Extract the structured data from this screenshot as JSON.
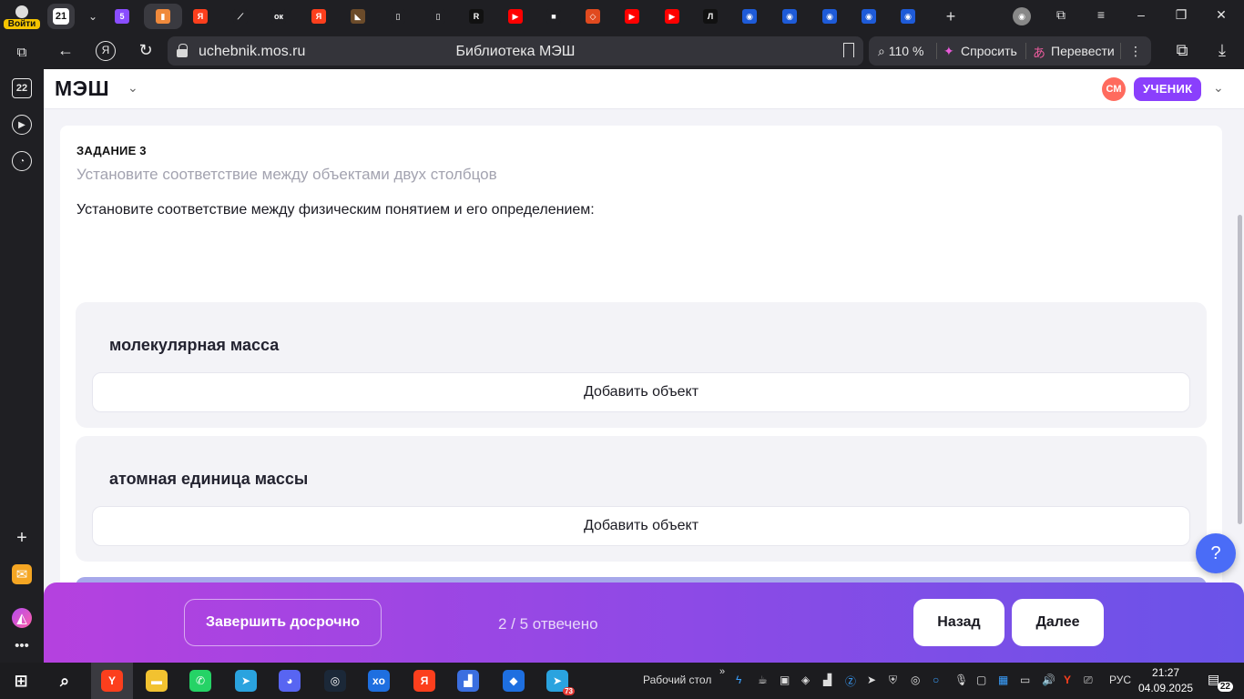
{
  "browser": {
    "login_label": "Войти",
    "tab_count": "21",
    "url": "uchebnik.mos.ru",
    "page_title": "Библиотека МЭШ",
    "zoom": "110 %",
    "ask_label": "Спросить",
    "translate_label": "Перевести",
    "rail_counter": "22",
    "tab_icons": [
      {
        "glyph": "5",
        "color": "#8a4dff"
      },
      {
        "glyph": "▮",
        "color": "#f08a3c"
      },
      {
        "glyph": "Я",
        "color": "#fc3f1d"
      },
      {
        "glyph": "⟋",
        "color": "#1f1f23"
      },
      {
        "glyph": "ок",
        "color": "#1f1f23"
      },
      {
        "glyph": "Я",
        "color": "#fc3f1d"
      },
      {
        "glyph": "◣",
        "color": "#6b4b2a"
      },
      {
        "glyph": "▯",
        "color": "#1f1f23"
      },
      {
        "glyph": "▯",
        "color": "#1f1f23"
      },
      {
        "glyph": "R",
        "color": "#111111"
      },
      {
        "glyph": "▶",
        "color": "#ff0000"
      },
      {
        "glyph": "■",
        "color": "#1f1f23"
      },
      {
        "glyph": "◇",
        "color": "#e04a1f"
      },
      {
        "glyph": "▶",
        "color": "#ff0000"
      },
      {
        "glyph": "▶",
        "color": "#ff0000"
      },
      {
        "glyph": "Л",
        "color": "#111111"
      },
      {
        "glyph": "◉",
        "color": "#1e5bd8"
      },
      {
        "glyph": "◉",
        "color": "#1e5bd8"
      },
      {
        "glyph": "◉",
        "color": "#1e5bd8"
      },
      {
        "glyph": "◉",
        "color": "#1e5bd8"
      },
      {
        "glyph": "◉",
        "color": "#1e5bd8"
      }
    ]
  },
  "header": {
    "logo": "МЭШ",
    "avatar_initials": "СМ",
    "role": "УЧЕНИК"
  },
  "task": {
    "label": "ЗАДАНИЕ 3",
    "instruction": "Установите соответствие между объектами двух столбцов",
    "question": "Установите соответствие между физическим понятием и его определением:",
    "groups": [
      {
        "title": "молекулярная масса",
        "add_label": "Добавить объект"
      },
      {
        "title": "атомная единица массы",
        "add_label": "Добавить объект"
      }
    ]
  },
  "footer": {
    "finish_label": "Завершить досрочно",
    "progress": "2 / 5 отвечено",
    "back_label": "Назад",
    "next_label": "Далее"
  },
  "help_glyph": "?",
  "taskbar": {
    "desktop_label": "Рабочий стол",
    "lang": "РУС",
    "time": "21:27",
    "date": "04.09.2025",
    "telegram_badge": "73",
    "notification_count": "22",
    "apps": [
      {
        "glyph": "Y",
        "color": "#fc3f1d"
      },
      {
        "glyph": "▬",
        "color": "#f2c230"
      },
      {
        "glyph": "✆",
        "color": "#25d366"
      },
      {
        "glyph": "➤",
        "color": "#2aa3df"
      },
      {
        "glyph": "◕",
        "color": "#5865f2"
      },
      {
        "glyph": "◎",
        "color": "#1b2838"
      },
      {
        "glyph": "xo",
        "color": "#1e6fe0"
      },
      {
        "glyph": "Я",
        "color": "#fc3f1d"
      },
      {
        "glyph": "▟",
        "color": "#3b6fe0"
      },
      {
        "glyph": "◆",
        "color": "#1e6fe0"
      },
      {
        "glyph": "➤",
        "color": "#2aa3df"
      }
    ]
  }
}
